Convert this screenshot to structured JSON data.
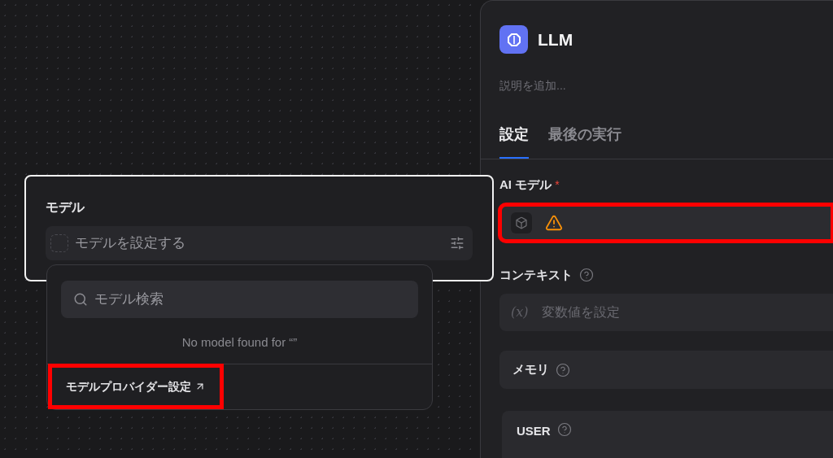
{
  "model_node": {
    "title": "モデル",
    "selector_placeholder": "モデルを設定する"
  },
  "model_dropdown": {
    "search_placeholder": "モデル検索",
    "empty_message": "No model found for “”",
    "provider_link": "モデルプロバイダー設定",
    "provider_link_highlighted": true
  },
  "panel": {
    "title": "LLM",
    "description_placeholder": "説明を追加...",
    "tabs": [
      {
        "label": "設定",
        "selected": true
      },
      {
        "label": "最後の実行",
        "selected": false
      }
    ],
    "fields": [
      {
        "kind": "model",
        "label": "AI モデル",
        "required_mark": "*",
        "warning": true,
        "highlighted": true
      },
      {
        "kind": "variable",
        "label": "コンテキスト",
        "help": true,
        "variable_icon": "(x)",
        "placeholder": "変数値を設定"
      },
      {
        "kind": "section",
        "label": "メモリ",
        "help": true
      },
      {
        "kind": "prompt",
        "label": "USER",
        "help": true
      }
    ]
  }
}
